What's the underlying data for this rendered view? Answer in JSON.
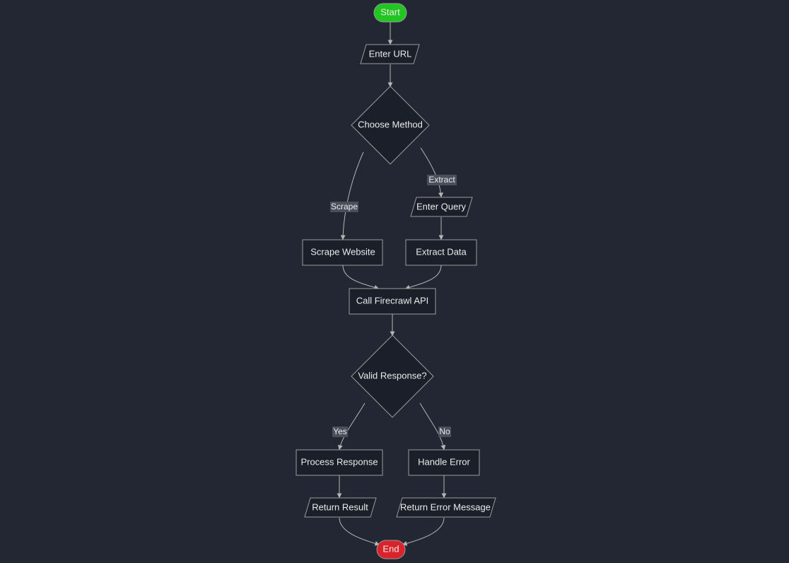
{
  "nodes": {
    "start": {
      "label": "Start",
      "type": "terminator-start"
    },
    "enter_url": {
      "label": "Enter URL",
      "type": "io"
    },
    "choose": {
      "label": "Choose Method",
      "type": "decision"
    },
    "enter_query": {
      "label": "Enter Query",
      "type": "io"
    },
    "scrape": {
      "label": "Scrape Website",
      "type": "process"
    },
    "extract": {
      "label": "Extract Data",
      "type": "process"
    },
    "call_api": {
      "label": "Call Firecrawl API",
      "type": "process"
    },
    "valid": {
      "label": "Valid Response?",
      "type": "decision"
    },
    "process_resp": {
      "label": "Process Response",
      "type": "process"
    },
    "handle_err": {
      "label": "Handle Error",
      "type": "process"
    },
    "return_res": {
      "label": "Return Result",
      "type": "io"
    },
    "return_err": {
      "label": "Return Error Message",
      "type": "io"
    },
    "end": {
      "label": "End",
      "type": "terminator-end"
    }
  },
  "edge_labels": {
    "scrape": "Scrape",
    "extract": "Extract",
    "yes": "Yes",
    "no": "No"
  },
  "edges": [
    {
      "from": "start",
      "to": "enter_url"
    },
    {
      "from": "enter_url",
      "to": "choose"
    },
    {
      "from": "choose",
      "to": "scrape",
      "label_key": "scrape"
    },
    {
      "from": "choose",
      "to": "enter_query",
      "label_key": "extract"
    },
    {
      "from": "enter_query",
      "to": "extract"
    },
    {
      "from": "scrape",
      "to": "call_api"
    },
    {
      "from": "extract",
      "to": "call_api"
    },
    {
      "from": "call_api",
      "to": "valid"
    },
    {
      "from": "valid",
      "to": "process_resp",
      "label_key": "yes"
    },
    {
      "from": "valid",
      "to": "handle_err",
      "label_key": "no"
    },
    {
      "from": "process_resp",
      "to": "return_res"
    },
    {
      "from": "handle_err",
      "to": "return_err"
    },
    {
      "from": "return_res",
      "to": "end"
    },
    {
      "from": "return_err",
      "to": "end"
    }
  ]
}
